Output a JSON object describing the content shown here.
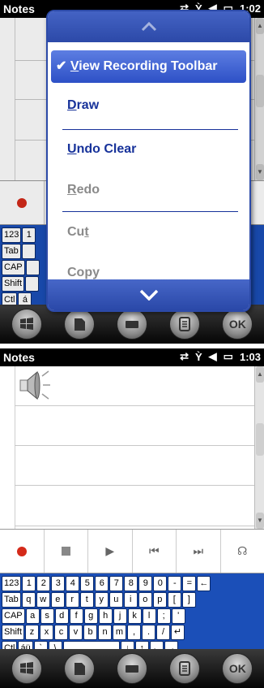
{
  "status_bar": {
    "app_title": "Notes",
    "time_screen1": "1:02",
    "time_screen2": "1:03",
    "icons": [
      "sync-icon",
      "no-signal-icon",
      "volume-icon",
      "battery-icon"
    ]
  },
  "menu": {
    "items": [
      {
        "key": "view_recording_toolbar",
        "label": "View Recording Toolbar",
        "accel": "V",
        "selected": true,
        "enabled": true
      },
      {
        "key": "draw",
        "label": "Draw",
        "accel": "D",
        "selected": false,
        "enabled": true
      },
      {
        "key": "undo_clear",
        "label": "Undo Clear",
        "accel": "U",
        "selected": false,
        "enabled": true
      },
      {
        "key": "redo",
        "label": "Redo",
        "accel": "R",
        "selected": false,
        "enabled": false
      },
      {
        "key": "cut",
        "label": "Cut",
        "accel": "t",
        "selected": false,
        "enabled": false
      },
      {
        "key": "copy",
        "label": "Copy",
        "accel": "",
        "selected": false,
        "enabled": false
      }
    ],
    "scroll_up_icon": "chevron-up-icon",
    "scroll_down_icon": "chevron-down-icon"
  },
  "recording_toolbar": {
    "buttons": [
      "record-icon",
      "stop-icon",
      "play-icon",
      "skip-back-icon",
      "skip-forward-icon",
      "volume-icon"
    ]
  },
  "keyboard": {
    "rows": [
      [
        "123",
        "1",
        "2",
        "3",
        "4",
        "5",
        "6",
        "7",
        "8",
        "9",
        "0",
        "-",
        "=",
        "←"
      ],
      [
        "Tab",
        "q",
        "w",
        "e",
        "r",
        "t",
        "y",
        "u",
        "i",
        "o",
        "p",
        "[",
        "]"
      ],
      [
        "CAP",
        "a",
        "s",
        "d",
        "f",
        "g",
        "h",
        "j",
        "k",
        "l",
        ";",
        "'"
      ],
      [
        "Shift",
        "z",
        "x",
        "c",
        "v",
        "b",
        "n",
        "m",
        ",",
        ".",
        "/",
        "↵"
      ],
      [
        "Ctl",
        "áü",
        "`",
        "\\",
        "↓",
        "↑",
        "←",
        "→"
      ]
    ]
  },
  "screen1_keyboard_visible": [
    [
      "123",
      "1"
    ],
    [
      "Tab",
      ""
    ],
    [
      "CAP",
      ""
    ],
    [
      "Shift",
      ""
    ],
    [
      "Ctl",
      "á"
    ]
  ],
  "taskbar": {
    "ok_label": "OK",
    "buttons": [
      "windows-start-icon",
      "new-note-icon",
      "keyboard-icon",
      "menu-icon",
      "ok-button"
    ]
  },
  "colors": {
    "menu_accent": "#2d50c6",
    "menu_text": "#17329a",
    "disabled_text": "#8a8a8a",
    "keyboard_bg": "#1b4fb8",
    "record_red": "#d42a1a"
  }
}
